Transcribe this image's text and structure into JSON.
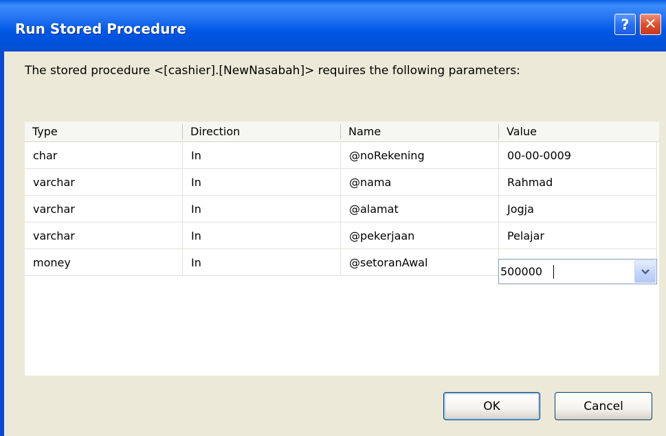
{
  "window": {
    "title": "Run Stored Procedure",
    "help_glyph": "?",
    "close_glyph": "✕",
    "frame_color": "#0a49d6"
  },
  "prompt": "The stored procedure <[cashier].[NewNasabah]> requires the following parameters:",
  "grid": {
    "columns": [
      "Type",
      "Direction",
      "Name",
      "Value"
    ],
    "rows": [
      {
        "type": "char",
        "direction": "In",
        "name": "@noRekening",
        "value": "00-00-0009"
      },
      {
        "type": "varchar",
        "direction": "In",
        "name": "@nama",
        "value": "Rahmad"
      },
      {
        "type": "varchar",
        "direction": "In",
        "name": "@alamat",
        "value": "Jogja"
      },
      {
        "type": "varchar",
        "direction": "In",
        "name": "@pekerjaan",
        "value": "Pelajar"
      },
      {
        "type": "money",
        "direction": "In",
        "name": "@setoranAwal",
        "value": "500000"
      }
    ],
    "editing_row": 4
  },
  "buttons": {
    "ok": "OK",
    "cancel": "Cancel"
  },
  "icons": {
    "help": "help-icon",
    "close": "close-icon",
    "dropdown": "chevron-down-icon"
  }
}
